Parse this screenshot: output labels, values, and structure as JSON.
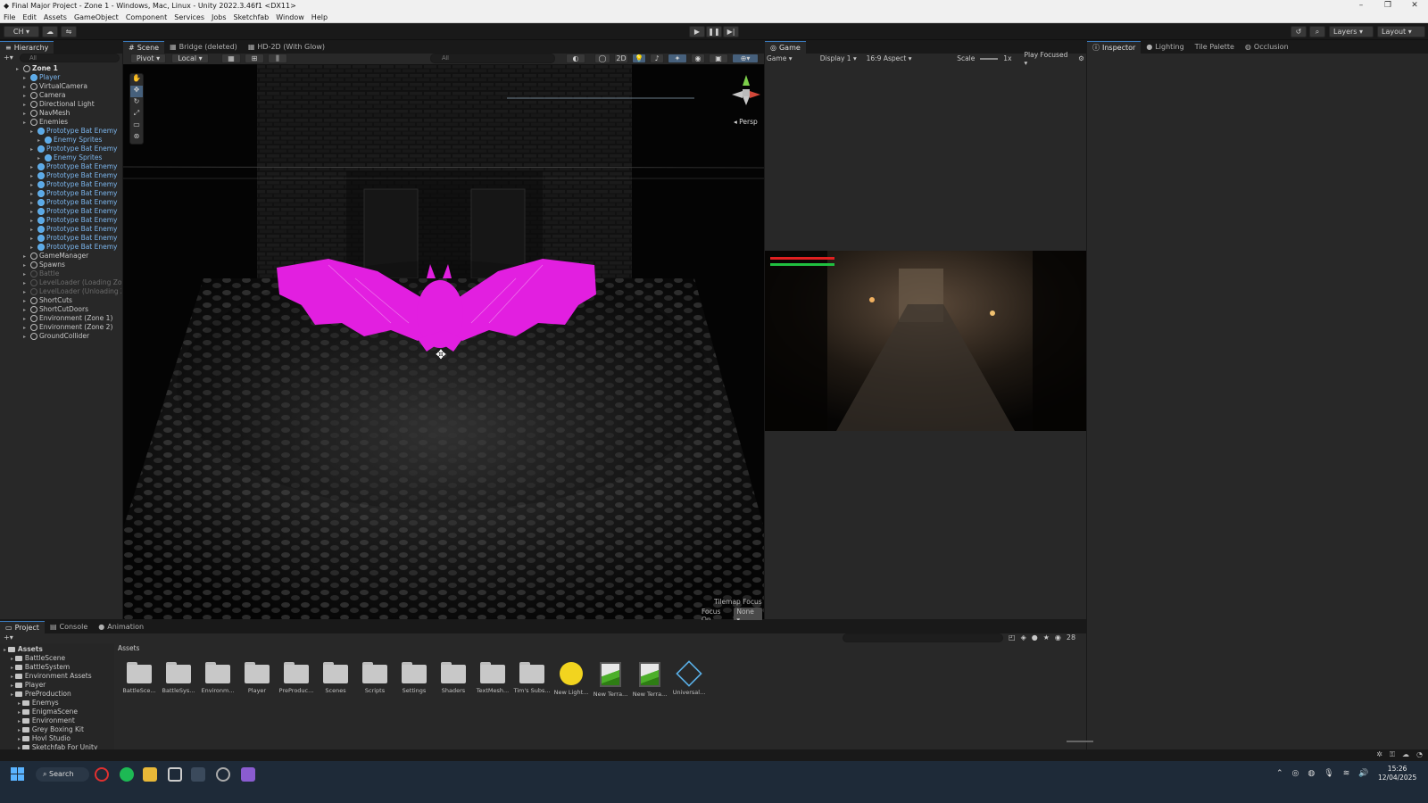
{
  "window": {
    "title": "Final Major Project - Zone 1 - Windows, Mac, Linux - Unity 2022.3.46f1 <DX11>",
    "controls": [
      "–",
      "❐",
      "✕"
    ]
  },
  "menu": [
    "File",
    "Edit",
    "Assets",
    "GameObject",
    "Component",
    "Services",
    "Jobs",
    "Sketchfab",
    "Window",
    "Help"
  ],
  "toolbar": {
    "account": "CH ▾",
    "layers": "Layers",
    "layout": "Layout"
  },
  "hierarchy": {
    "tab": "Hierarchy",
    "search_placeholder": "All",
    "rows": [
      {
        "label": "Zone 1",
        "indent": 0,
        "kind": "scene"
      },
      {
        "label": "Player",
        "indent": 1,
        "kind": "prefab"
      },
      {
        "label": "VirtualCamera",
        "indent": 1,
        "kind": "normal"
      },
      {
        "label": "Camera",
        "indent": 1,
        "kind": "normal"
      },
      {
        "label": "Directional Light",
        "indent": 1,
        "kind": "normal"
      },
      {
        "label": "NavMesh",
        "indent": 1,
        "kind": "normal"
      },
      {
        "label": "Enemies",
        "indent": 1,
        "kind": "normal"
      },
      {
        "label": "Prototype Bat Enemy",
        "indent": 2,
        "kind": "prefab"
      },
      {
        "label": "Enemy Sprites",
        "indent": 3,
        "kind": "prefab"
      },
      {
        "label": "Prototype Bat Enemy",
        "indent": 2,
        "kind": "prefab"
      },
      {
        "label": "Enemy Sprites",
        "indent": 3,
        "kind": "prefab"
      },
      {
        "label": "Prototype Bat Enemy",
        "indent": 2,
        "kind": "prefab"
      },
      {
        "label": "Prototype Bat Enemy",
        "indent": 2,
        "kind": "prefab"
      },
      {
        "label": "Prototype Bat Enemy",
        "indent": 2,
        "kind": "prefab"
      },
      {
        "label": "Prototype Bat Enemy",
        "indent": 2,
        "kind": "prefab"
      },
      {
        "label": "Prototype Bat Enemy",
        "indent": 2,
        "kind": "prefab"
      },
      {
        "label": "Prototype Bat Enemy",
        "indent": 2,
        "kind": "prefab"
      },
      {
        "label": "Prototype Bat Enemy",
        "indent": 2,
        "kind": "prefab"
      },
      {
        "label": "Prototype Bat Enemy",
        "indent": 2,
        "kind": "prefab"
      },
      {
        "label": "Prototype Bat Enemy",
        "indent": 2,
        "kind": "prefab"
      },
      {
        "label": "Prototype Bat Enemy",
        "indent": 2,
        "kind": "prefab"
      },
      {
        "label": "GameManager",
        "indent": 1,
        "kind": "normal"
      },
      {
        "label": "Spawns",
        "indent": 1,
        "kind": "normal"
      },
      {
        "label": "Battle",
        "indent": 1,
        "kind": "dim"
      },
      {
        "label": "LevelLoader (Loading Zone)",
        "indent": 1,
        "kind": "dim"
      },
      {
        "label": "LevelLoader (Unloading Zone)",
        "indent": 1,
        "kind": "dim"
      },
      {
        "label": "ShortCuts",
        "indent": 1,
        "kind": "normal"
      },
      {
        "label": "ShortCutDoors",
        "indent": 1,
        "kind": "normal"
      },
      {
        "label": "Environment (Zone 1)",
        "indent": 1,
        "kind": "normal"
      },
      {
        "label": "Environment (Zone 2)",
        "indent": 1,
        "kind": "normal"
      },
      {
        "label": "GroundCollider",
        "indent": 1,
        "kind": "normal"
      }
    ]
  },
  "scene": {
    "tabs": [
      "Scene",
      "Bridge (deleted)",
      "HD-2D (With Glow)"
    ],
    "pivot": "Pivot",
    "local": "Local",
    "search_placeholder": "All",
    "mode_2d": "2D",
    "persp": "Persp",
    "tilemap_focus": "Tilemap Focus",
    "focus_on_label": "Focus On",
    "focus_on_value": "None"
  },
  "game": {
    "tab": "Game",
    "mode": "Game",
    "display": "Display 1",
    "aspect": "16:9 Aspect",
    "scale_label": "Scale",
    "scale_value": "1x",
    "play_focused": "Play Focused"
  },
  "inspector_tabs": [
    "Inspector",
    "Lighting",
    "Tile Palette",
    "Occlusion"
  ],
  "project": {
    "tabs": [
      "Project",
      "Console",
      "Animation"
    ],
    "count": "28",
    "breadcrumb": "Assets",
    "tree": [
      {
        "label": "Assets",
        "indent": 0
      },
      {
        "label": "BattleScene",
        "indent": 1
      },
      {
        "label": "BattleSystem",
        "indent": 1
      },
      {
        "label": "Environment Assets",
        "indent": 1
      },
      {
        "label": "Player",
        "indent": 1
      },
      {
        "label": "PreProduction",
        "indent": 1
      },
      {
        "label": "Enemys",
        "indent": 2
      },
      {
        "label": "EnigmaScene",
        "indent": 2
      },
      {
        "label": "Environment",
        "indent": 2
      },
      {
        "label": "Grey Boxing Kit",
        "indent": 2
      },
      {
        "label": "Hovl Studio",
        "indent": 2
      },
      {
        "label": "Sketchfab For Unity",
        "indent": 2
      }
    ],
    "assets": [
      {
        "label": "BattleSce...",
        "type": "folder"
      },
      {
        "label": "BattleSys...",
        "type": "folder"
      },
      {
        "label": "Environm...",
        "type": "folder"
      },
      {
        "label": "Player",
        "type": "folder"
      },
      {
        "label": "PreProduc...",
        "type": "folder"
      },
      {
        "label": "Scenes",
        "type": "folder"
      },
      {
        "label": "Scripts",
        "type": "folder"
      },
      {
        "label": "Settings",
        "type": "folder"
      },
      {
        "label": "Shaders",
        "type": "folder"
      },
      {
        "label": "TextMesh...",
        "type": "folder"
      },
      {
        "label": "Tim's Subs...",
        "type": "folder"
      },
      {
        "label": "New Light...",
        "type": "lighting"
      },
      {
        "label": "New Terra...",
        "type": "terrain"
      },
      {
        "label": "New Terra...",
        "type": "terrain"
      },
      {
        "label": "Universal...",
        "type": "package"
      }
    ]
  },
  "taskbar": {
    "search": "Search",
    "time": "15:26",
    "date": "12/04/2025"
  }
}
